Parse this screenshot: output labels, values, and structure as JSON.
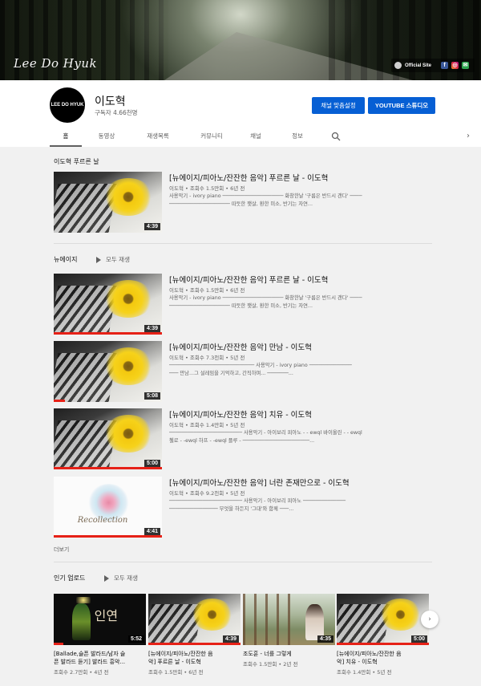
{
  "banner": {
    "signature": "Lee Do Hyuk",
    "official_site_label": "Official Site",
    "social_icons": [
      "globe-icon",
      "facebook-icon",
      "instagram-icon",
      "gmail-icon"
    ]
  },
  "channel": {
    "avatar_text": "LEE DO HYUK",
    "name": "이도혁",
    "subscribers": "구독자 4.66천명",
    "customize_button": "채널 맞춤설정",
    "studio_button": "YOUTUBE 스튜디오"
  },
  "tabs": [
    {
      "label": "홈",
      "active": true
    },
    {
      "label": "동영상",
      "active": false
    },
    {
      "label": "재생목록",
      "active": false
    },
    {
      "label": "커뮤니티",
      "active": false
    },
    {
      "label": "채널",
      "active": false
    },
    {
      "label": "정보",
      "active": false
    }
  ],
  "featured": {
    "shelf_title": "이도혁 푸르른 날",
    "video": {
      "title": "[뉴에이지/피아노/잔잔한 음악] 푸르른 날 - 이도혁",
      "meta": "이도혁 • 조회수 1.5만회 • 6년 전",
      "desc1": "사용악기 - ivory piano ──────────────────── 화창한날 '구름은 반드시 갠다' ────",
      "desc2": "──────────────────── 따듯한 햇살, 환한 미소, 반기는 자연...",
      "duration": "4:39"
    }
  },
  "newage": {
    "shelf_title": "뉴에이지",
    "play_all": "모두 재생",
    "videos": [
      {
        "title": "[뉴에이지/피아노/잔잔한 음악] 푸르른 날 - 이도혁",
        "meta": "이도혁 • 조회수 1.5만회 • 6년 전",
        "desc1": "사용악기 - ivory piano ──────────────────── 화창한날 '구름은 반드시 갠다' ────",
        "desc2": "──────────────────── 따듯한 햇살, 환한 미소, 반기는 자연...",
        "duration": "4:39",
        "progress": 1.0
      },
      {
        "title": "[뉴에이지/피아노/잔잔한 음악] 만남 - 이도혁",
        "meta": "이도혁 • 조회수 7.3천회 • 5년 전",
        "desc1": "──────────────────────────── 사용악기 - ivory piano ──────────────",
        "desc2": "─── 만남...그 설레임을 기억하고, 간직하며... ───────...",
        "duration": "5:08",
        "progress": 0.1
      },
      {
        "title": "[뉴에이지/피아노/잔잔한 음악] 치유 - 이도혁",
        "meta": "이도혁 • 조회수 1.4만회 • 5년 전",
        "desc1": "──────────────────────── 사용악기 - 아이보리 피아노 - - ewql 바이올린 - - ewql",
        "desc2": "첼로 - -ewql 하프 - -ewql 플루 - ──────────────────────...",
        "duration": "5:00",
        "progress": 1.0
      },
      {
        "title": "[뉴에이지/피아노/잔잔한 음악] 너란 존재만으로 - 이도혁",
        "meta": "이도혁 • 조회수 9.2천회 • 5년 전",
        "desc1": "──────────────────────── 사용악기 - 아이보리 피아노 ──────────────",
        "desc2": "──────────────── 무엇을 하든지 '그대'와 함께 ───...",
        "duration": "4:41",
        "caption": "Recollection",
        "progress": 1.0
      }
    ],
    "more_label": "더보기"
  },
  "popular": {
    "shelf_title": "인기 업로드",
    "play_all": "모두 재생",
    "cards": [
      {
        "title": "[Ballade,슬픈 발라드/남자 슬\n픈 발라드 듣기] 발라드 흥악...",
        "meta": "조회수 2.7만회 • 4년 전",
        "duration": "5:52",
        "thumb_text": "인연",
        "progress": 0.1
      },
      {
        "title": "[뉴에이지/피아노/잔잔한 음\n악] 푸르른 날 - 이도혁",
        "meta": "조회수 1.5만회 • 6년 전",
        "duration": "4:39",
        "progress": 1.0
      },
      {
        "title": "조도훈 - 너를 그렇게",
        "meta": "조회수 1.5만회 • 2년 전",
        "duration": "4:35",
        "progress": 0.0
      },
      {
        "title": "[뉴에이지/피아노/잔잔한 음\n악] 치유 - 이도혁",
        "meta": "조회수 1.4만회 • 5년 전",
        "duration": "5:00",
        "progress": 1.0
      }
    ]
  },
  "colors": {
    "accent_blue": "#065fd4",
    "progress_red": "#e62117",
    "background": "#f1f1f1"
  }
}
